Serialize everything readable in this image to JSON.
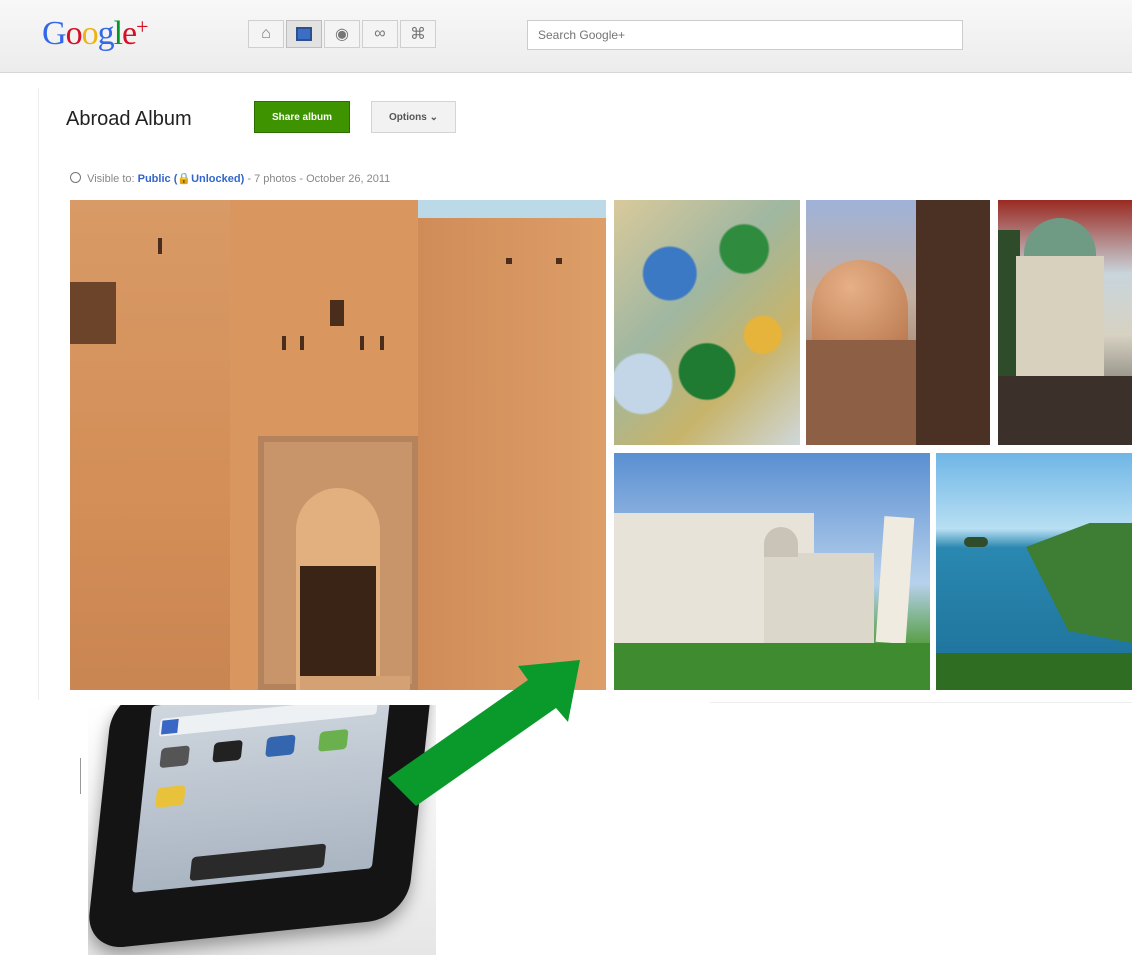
{
  "header": {
    "logo_text": "Google",
    "logo_plus": "+",
    "nav_icons": [
      "home-icon",
      "photos-icon",
      "profile-icon",
      "circles-icon",
      "games-icon"
    ],
    "search_placeholder": "Search Google+"
  },
  "album": {
    "title": "Abroad Album",
    "share_label": "Share album",
    "options_label": "Options",
    "visibility_prefix": "Visible to:",
    "visibility_value": "Public",
    "lock_state": "Unlocked",
    "photo_count": "7 photos",
    "date": "October 26, 2011"
  },
  "photos": [
    {
      "name": "fort-photo"
    },
    {
      "name": "mosaic-photo"
    },
    {
      "name": "dome-photo"
    },
    {
      "name": "berlin-cathedral-photo"
    },
    {
      "name": "pisa-photo"
    },
    {
      "name": "coast-photo"
    }
  ],
  "colors": {
    "share_button": "#3d9400",
    "link": "#3366cc",
    "arrow": "#0a9a2c"
  }
}
